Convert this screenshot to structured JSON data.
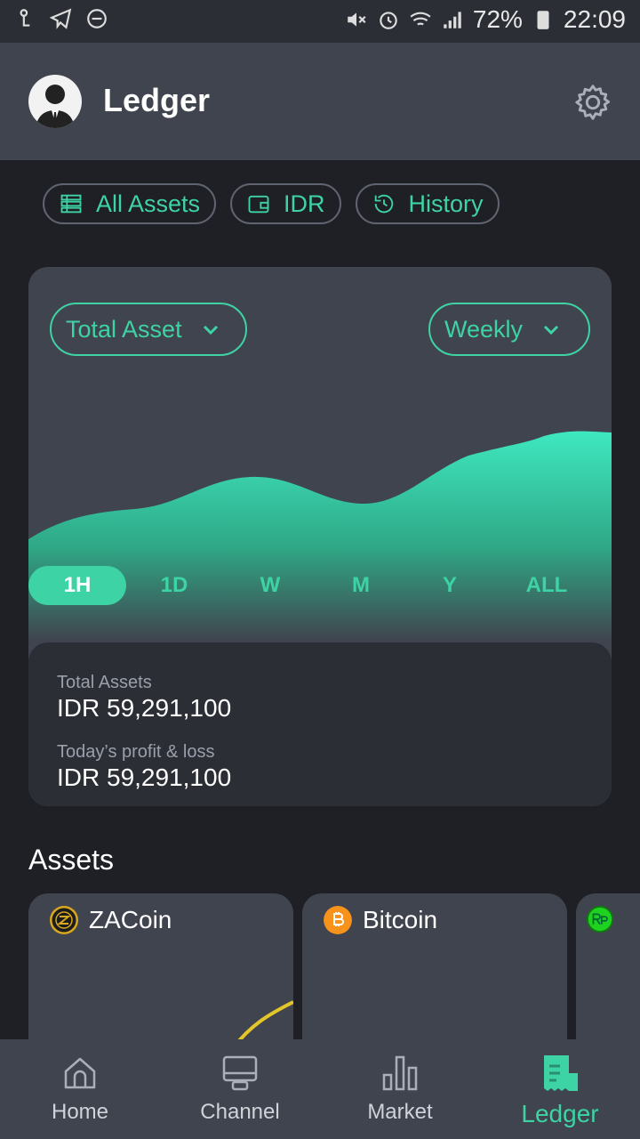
{
  "status_bar": {
    "battery": "72%",
    "time": "22:09"
  },
  "app_bar": {
    "title": "Ledger"
  },
  "filters": [
    {
      "label": "All Assets",
      "icon": "stack-icon"
    },
    {
      "label": "IDR",
      "icon": "wallet-icon"
    },
    {
      "label": "History",
      "icon": "history-icon"
    }
  ],
  "chart_card": {
    "asset_select": "Total Asset",
    "period_select": "Weekly",
    "ranges": [
      "1H",
      "1D",
      "W",
      "M",
      "Y",
      "ALL"
    ],
    "active_range": "1H"
  },
  "summary": {
    "total_label": "Total Assets",
    "total_value": "IDR 59,291,100",
    "pnl_label": "Today’s profit & loss",
    "pnl_value": "IDR 59,291,100"
  },
  "assets": {
    "title": "Assets",
    "items": [
      {
        "name": "ZACoin",
        "icon": "zacoin-icon"
      },
      {
        "name": "Bitcoin",
        "icon": "bitcoin-icon"
      },
      {
        "name": "",
        "icon": "rupiah-icon"
      }
    ]
  },
  "bottom_nav": [
    {
      "label": "Home",
      "icon": "home-icon"
    },
    {
      "label": "Channel",
      "icon": "channel-icon"
    },
    {
      "label": "Market",
      "icon": "market-icon"
    },
    {
      "label": "Ledger",
      "icon": "ledger-icon",
      "active": true
    }
  ],
  "colors": {
    "accent": "#3ed3a4",
    "card": "#40444e",
    "background": "#1e2025"
  }
}
